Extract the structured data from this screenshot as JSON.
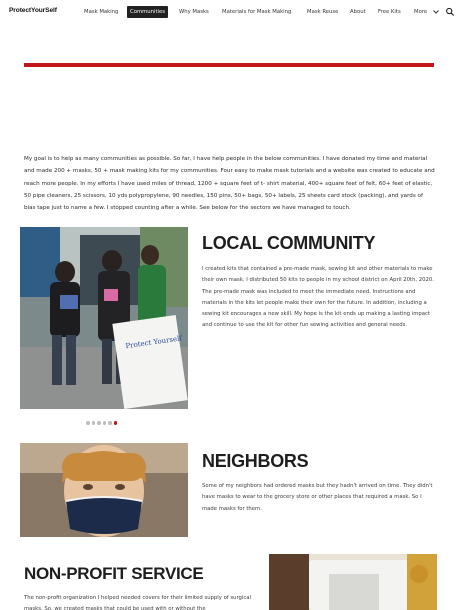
{
  "site": {
    "brand": "ProtectYourSelf"
  },
  "nav": {
    "items": [
      {
        "label": "Mask Making",
        "active": false
      },
      {
        "label": "Communities",
        "active": true
      },
      {
        "label": "Why Masks",
        "active": false
      },
      {
        "label": "Materials for Mask Making",
        "active": false
      },
      {
        "label": "Mask Reuse",
        "active": false
      },
      {
        "label": "About",
        "active": false
      },
      {
        "label": "Free Kits",
        "active": false
      },
      {
        "label": "More",
        "active": false
      }
    ],
    "icons": {
      "more": "chevron-down-icon",
      "search": "search-icon"
    }
  },
  "colors": {
    "accent": "#c0161c",
    "active_nav_bg": "#212121",
    "text": "#212121"
  },
  "intro": {
    "text": "My goal is to help as many communities as possible. So far, I have help people in the below communities.  I have donated my time and material and made 200 + masks, 50 + mask making kits for my communities.  Four easy to make mask tutorials and a website was created to educate and reach more people. In my efforts I have used miles of thread, 1200 + square feet of t- shirt material, 400+ square feet of felt, 60+ feet of elastic, 50 pipe cleaners, 25 scissors, 10 yds polypropylene, 90 needles, 150 pins, 50+ bags, 50+ labels, 25 sheets card stock (packing), and yards of bias tape just to name a few. I stopped counting after a while. See below for the sectors we have managed to touch."
  },
  "sections": {
    "local": {
      "title": "LOCAL COMMUNITY",
      "body": "I created kits that contained a pre-made mask, sewing kit and  other materials to make their own mask. I distributed 50 kits to people in my school district on April 20th, 2020. The pre-made mask was included to meet the immediate need. Instructions and materials in the kits let people make their own for the future. In addition, including a sewing kit encourages a new skill. My hope is the kit ends up making a lasting impact and continue to use the kit for other fun sewing activities and general needs.",
      "carousel": {
        "count": 6,
        "active_index": 5
      }
    },
    "neighbors": {
      "title": "NEIGHBORS",
      "body": "Some of my neighbors had ordered masks but they hadn't arrived on time. They didn't have masks to wear to the grocery store or other places that required a mask. So I made masks for them."
    },
    "nonprofit": {
      "title": "NON-PROFIT SERVICE",
      "body": "The non-profit organization I helped needed covers for their limited supply of surgical masks. So, we created masks that could be used with or without the"
    }
  }
}
